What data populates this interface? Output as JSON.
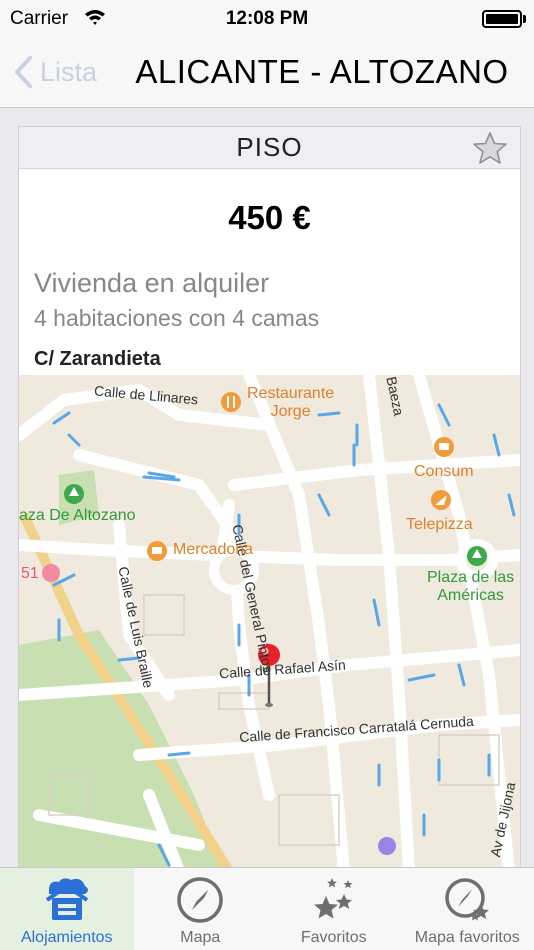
{
  "status_bar": {
    "carrier": "Carrier",
    "time": "12:08 PM"
  },
  "nav": {
    "back_label": "Lista",
    "title": "ALICANTE - ALTOZANO"
  },
  "listing": {
    "type": "PISO",
    "price": "450 €",
    "description_title": "Vivienda en alquiler",
    "description_sub": "4 habitaciones con 4 camas",
    "address": "C/ Zarandieta"
  },
  "map": {
    "streets": [
      "Calle de Llinares",
      "Calle del General Pintos",
      "Calle de Luis Braille",
      "Calle de Rafael Asín",
      "Calle de Francisco Carratalá Cernuda",
      "Av de Jijona",
      "Baeza"
    ],
    "pois": {
      "restaurant": [
        "Restaurante",
        "Jorge"
      ],
      "consum": "Consum",
      "telepizza": "Telepizza",
      "mercadona": "Mercadona",
      "plaza_altozano": "aza De Altozano",
      "plaza_americas": [
        "Plaza de las",
        "Américas"
      ],
      "number": "51"
    }
  },
  "tabs": [
    {
      "label": "Alojamientos",
      "icon": "house-icon",
      "active": true
    },
    {
      "label": "Mapa",
      "icon": "compass-icon",
      "active": false
    },
    {
      "label": "Favoritos",
      "icon": "stars-icon",
      "active": false
    },
    {
      "label": "Mapa favoritos",
      "icon": "compass-star-icon",
      "active": false
    }
  ],
  "colors": {
    "accent": "#2c6fd6",
    "pin": "#e8222a",
    "park": "#c7dfb1",
    "poi_orange": "#f39a3a",
    "poi_green": "#2f9a3a"
  }
}
